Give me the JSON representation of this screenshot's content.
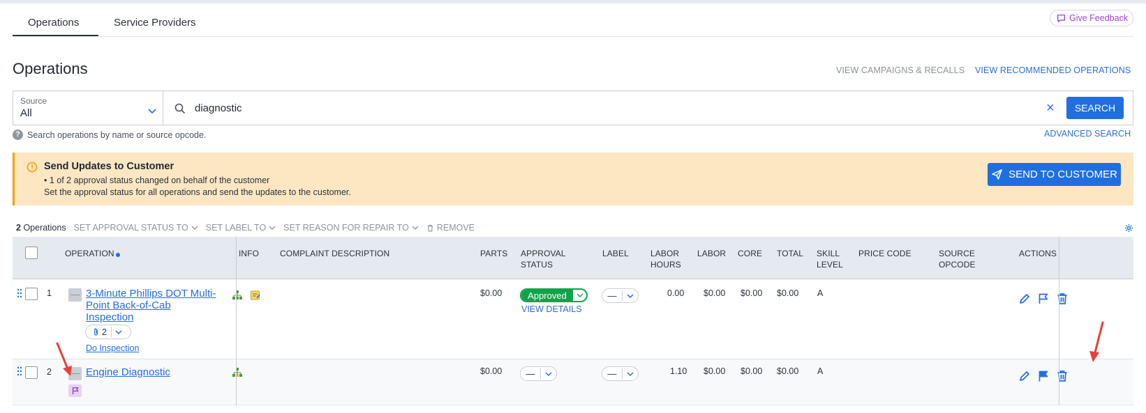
{
  "tabs": [
    {
      "label": "Operations",
      "active": true
    },
    {
      "label": "Service Providers",
      "active": false
    }
  ],
  "feedback_label": "Give Feedback",
  "page_title": "Operations",
  "header_links": {
    "campaigns": "VIEW CAMPAIGNS & RECALLS",
    "recommended": "VIEW RECOMMENDED OPERATIONS"
  },
  "search": {
    "source_label": "Source",
    "source_value": "All",
    "query": "diagnostic",
    "button": "SEARCH",
    "clear": "×",
    "hint": "Search operations by name or source opcode.",
    "advanced": "ADVANCED SEARCH"
  },
  "alert": {
    "title": "Send Updates to Customer",
    "line1": "• 1 of 2 approval status changed on behalf of the customer",
    "line2": "Set the approval status for all operations and send the updates to the customer.",
    "button": "SEND TO CUSTOMER"
  },
  "bulk": {
    "count_number": "2",
    "count_label": "Operations",
    "set_approval": "SET APPROVAL STATUS TO",
    "set_label": "SET LABEL TO",
    "set_reason": "SET REASON FOR REPAIR TO",
    "remove": "REMOVE"
  },
  "columns": {
    "operation": "OPERATION",
    "info": "INFO",
    "complaint": "COMPLAINT DESCRIPTION",
    "parts": "PARTS",
    "approval_1": "APPROVAL",
    "approval_2": "STATUS",
    "label": "LABEL",
    "labor_hours_1": "LABOR",
    "labor_hours_2": "HOURS",
    "labor": "LABOR",
    "core": "CORE",
    "total": "TOTAL",
    "skill_1": "SKILL",
    "skill_2": "LEVEL",
    "price_code": "PRICE CODE",
    "source_opcode_1": "SOURCE",
    "source_opcode_2": "OPCODE",
    "actions": "ACTIONS"
  },
  "rows": [
    {
      "num": "1",
      "minus": "—",
      "name_line1": "3-Minute Phillips DOT Multi-",
      "name_line2": "Point Back-of-Cab",
      "name_line3": "Inspection",
      "attachments": "2",
      "inspection_link": "Do Inspection",
      "parts": "$0.00",
      "approval": "Approved",
      "view_details": "VIEW DETAILS",
      "label": "—",
      "labor_hours": "0.00",
      "labor": "$0.00",
      "core": "$0.00",
      "total": "$0.00",
      "skill": "A"
    },
    {
      "num": "2",
      "minus": "—",
      "name": "Engine Diagnostic",
      "parts": "$0.00",
      "approval": "—",
      "label": "—",
      "labor_hours": "1.10",
      "labor": "$0.00",
      "core": "$0.00",
      "total": "$0.00",
      "skill": "A"
    }
  ],
  "colors": {
    "accent": "#1f6fe0",
    "approved": "#12a34a",
    "alert_bg": "#fde6c2",
    "feedback": "#a142d1",
    "annotation_arrow": "#e8413b"
  }
}
